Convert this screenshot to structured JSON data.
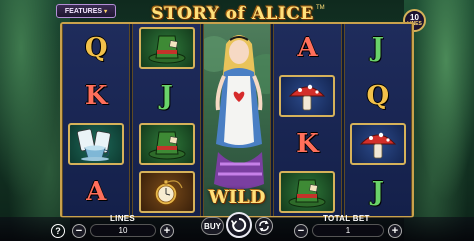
{
  "header": {
    "features_label": "FEATURES",
    "features_chevron": "▾",
    "logo_text": "STORY of ALICE",
    "logo_tm": "TM",
    "lines_badge_number": "10",
    "lines_badge_label": "LINES"
  },
  "reels": [
    {
      "symbols": [
        {
          "type": "letter",
          "value": "Q"
        },
        {
          "type": "letter",
          "value": "K"
        },
        {
          "type": "icon",
          "value": "teacups-cards"
        },
        {
          "type": "letter",
          "value": "A"
        }
      ]
    },
    {
      "symbols": [
        {
          "type": "icon",
          "value": "mad-hatter-hat"
        },
        {
          "type": "letter",
          "value": "J"
        },
        {
          "type": "icon",
          "value": "mad-hatter-hat"
        },
        {
          "type": "icon",
          "value": "pocket-watch"
        }
      ]
    },
    {
      "symbols": [
        {
          "type": "wild",
          "value": "alice"
        }
      ]
    },
    {
      "symbols": [
        {
          "type": "letter",
          "value": "A"
        },
        {
          "type": "icon",
          "value": "red-mushroom"
        },
        {
          "type": "letter",
          "value": "K"
        },
        {
          "type": "icon",
          "value": "mad-hatter-hat"
        }
      ]
    },
    {
      "symbols": [
        {
          "type": "letter",
          "value": "J"
        },
        {
          "type": "letter",
          "value": "Q"
        },
        {
          "type": "icon",
          "value": "red-mushroom"
        },
        {
          "type": "letter",
          "value": "J"
        }
      ]
    }
  ],
  "wild_label": "WILD",
  "controls": {
    "help": "?",
    "lines_label": "LINES",
    "lines_value": "10",
    "minus": "−",
    "plus": "+",
    "buy_label": "BUY",
    "total_bet_label": "TOTAL BET",
    "total_bet_value": "1"
  },
  "colors": {
    "gold": "#d6b25a",
    "reel_blue": "#1f2c5c",
    "letter_red": "#ff6f5b",
    "letter_gold": "#f2c14a",
    "letter_green": "#6ad36a"
  }
}
